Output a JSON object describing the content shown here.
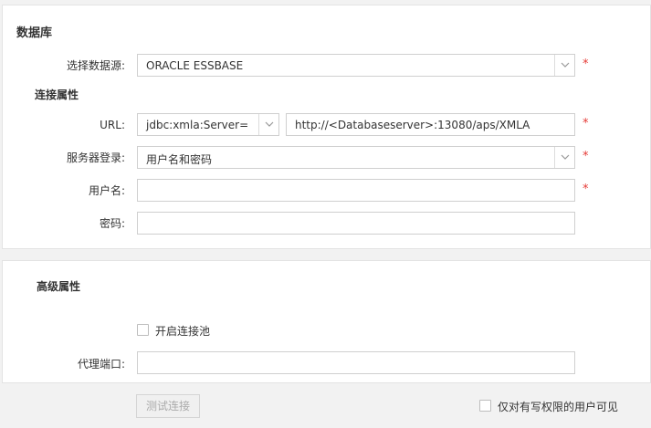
{
  "database_section": {
    "title": "数据库",
    "datasource": {
      "label": "选择数据源:",
      "value": "ORACLE ESSBASE",
      "required_mark": "*"
    },
    "connection_props_title": "连接属性",
    "url": {
      "label": "URL:",
      "prefix_value": "jdbc:xmla:Server=",
      "value": "http://<Databaseserver>:13080/aps/XMLA",
      "required_mark": "*"
    },
    "server_login": {
      "label": "服务器登录:",
      "value": "用户名和密码",
      "required_mark": "*"
    },
    "username": {
      "label": "用户名:",
      "value": "",
      "required_mark": "*"
    },
    "password": {
      "label": "密码:",
      "value": ""
    }
  },
  "advanced_section": {
    "title": "高级属性",
    "connection_pool": {
      "label": "开启连接池",
      "checked": false
    },
    "proxy_port": {
      "label": "代理端口:",
      "value": ""
    }
  },
  "footer": {
    "test_button": "测试连接",
    "writer_only": {
      "label": "仅对有写权限的用户可见",
      "checked": false
    }
  },
  "colors": {
    "required": "#e53935",
    "border": "#cfcfcf",
    "background": "#f2f2f2"
  }
}
